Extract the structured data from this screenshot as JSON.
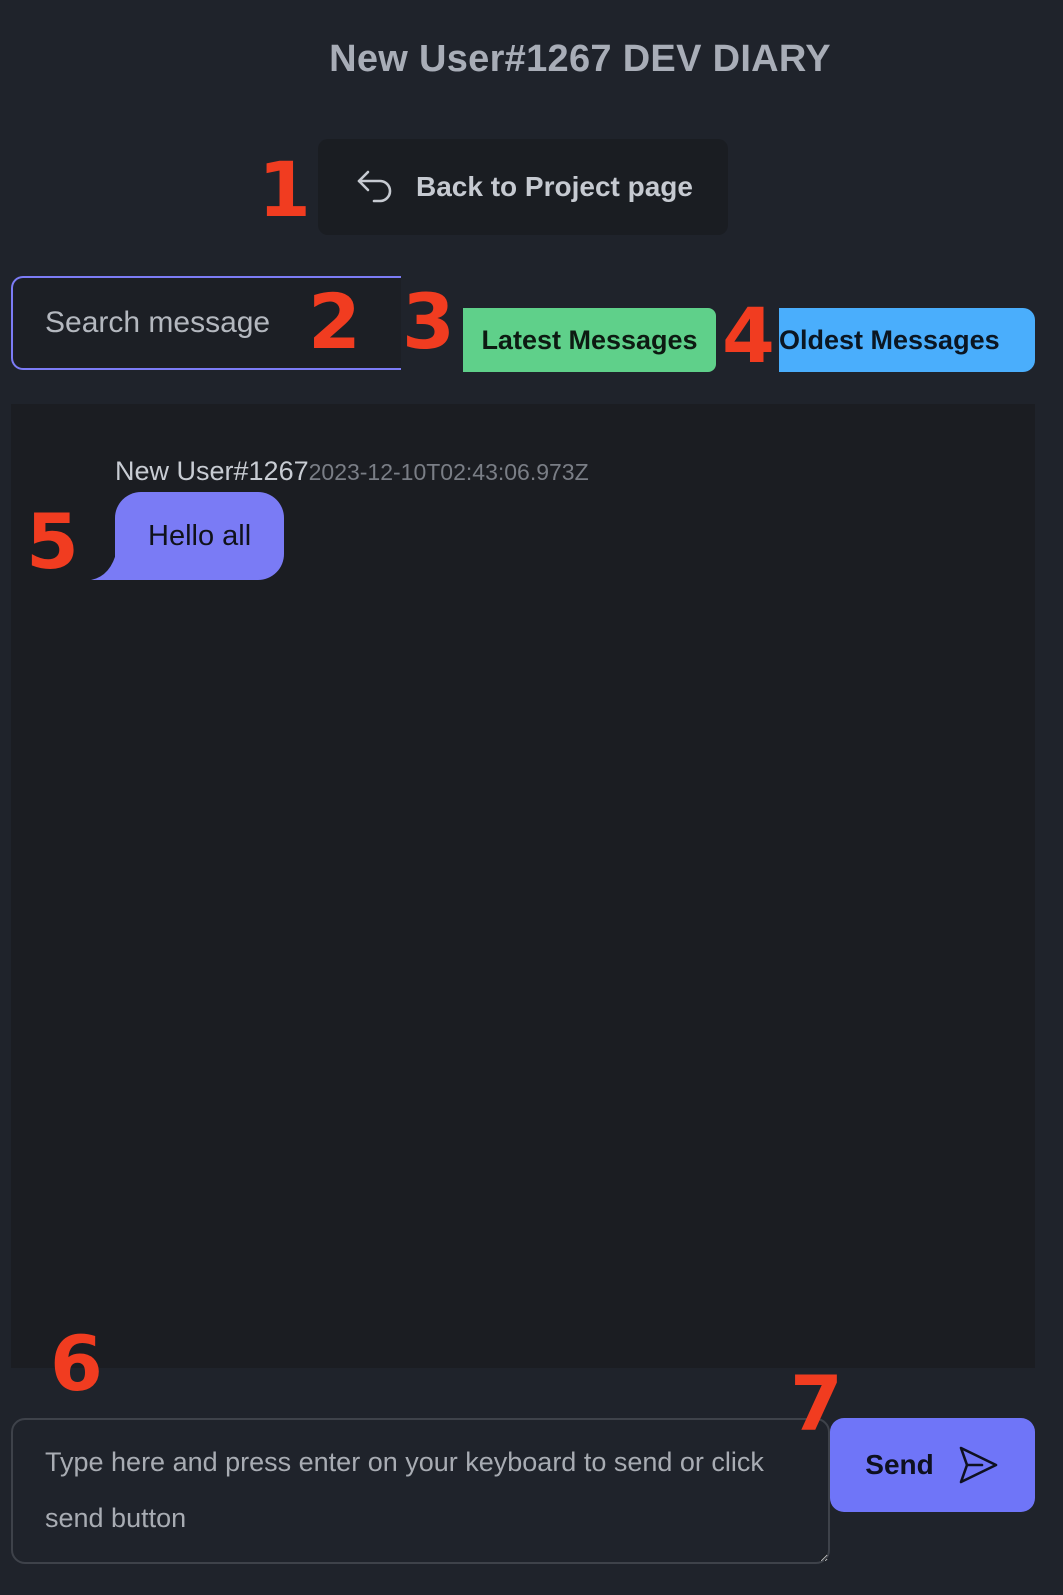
{
  "page_title": "New User#1267 DEV DIARY",
  "back_button": {
    "label": "Back to Project page",
    "icon": "undo-arrow-icon"
  },
  "search": {
    "placeholder": "Search message"
  },
  "sort_buttons": {
    "latest_label": "Latest Messages",
    "oldest_label": "Oldest Messages"
  },
  "messages": [
    {
      "author": "New User#1267",
      "timestamp": "2023-12-10T02:43:06.973Z",
      "text": "Hello all"
    }
  ],
  "composer": {
    "placeholder": "Type here and press enter on your keyboard to send or click send button"
  },
  "send_button": {
    "label": "Send",
    "icon": "send-icon"
  },
  "annotations": [
    "1",
    "2",
    "3",
    "4",
    "5",
    "6",
    "7"
  ],
  "colors": {
    "background": "#1f232b",
    "chat_area": "#1b1d22",
    "accent": "#7a7bf5",
    "latest_button": "#5fd08a",
    "oldest_button": "#4aaefc",
    "annotation": "#f13c20"
  }
}
